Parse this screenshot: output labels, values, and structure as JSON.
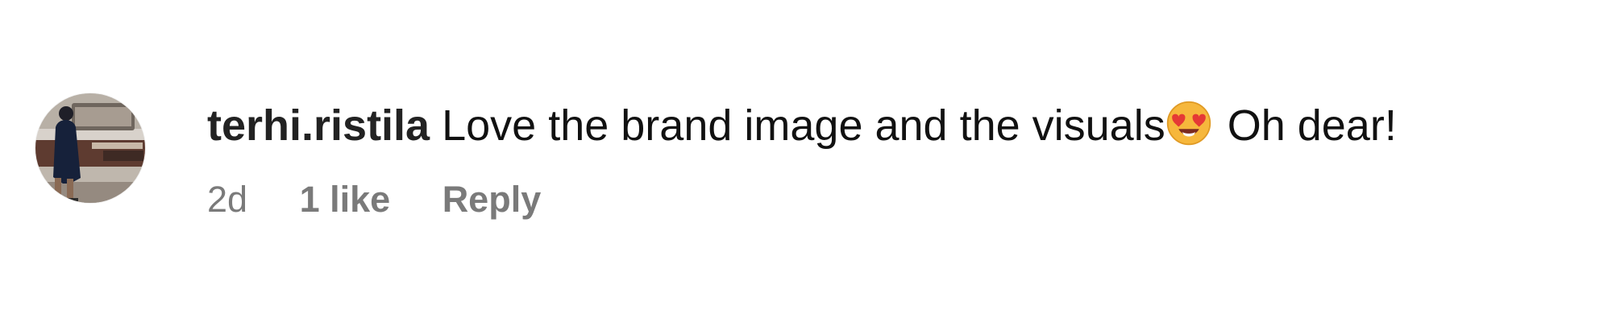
{
  "comment": {
    "username": "terhi.ristila",
    "text_before_emoji": "Love the brand image and the visuals",
    "emoji": "😍",
    "text_after_emoji": " Oh dear!",
    "time": "2d",
    "likes": "1 like",
    "reply": "Reply",
    "avatar_icon": "user-avatar-photo",
    "emoji_icon": "smiling-face-with-heart-eyes-icon"
  },
  "colors": {
    "text_primary": "#111111",
    "text_secondary": "#7a7a7a",
    "background": "#ffffff",
    "emoji_yellow": "#f6b73c",
    "emoji_red": "#e53935"
  }
}
